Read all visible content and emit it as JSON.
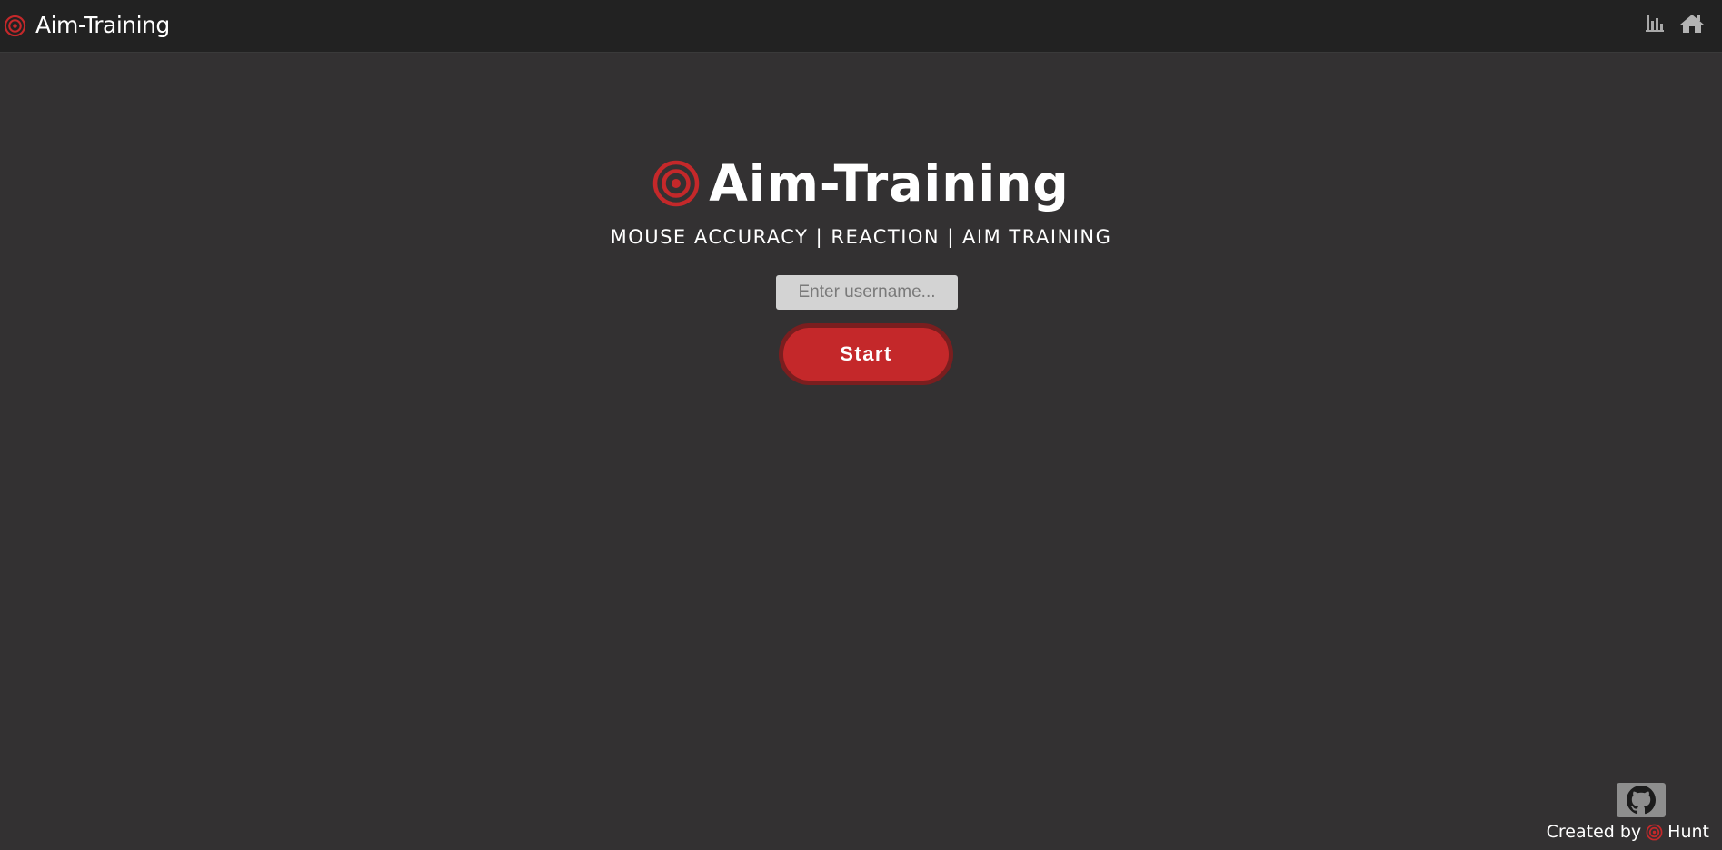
{
  "navbar": {
    "brand_icon": "target-icon",
    "brand_text": "Aim-Training",
    "stats_icon": "bar-chart-icon",
    "home_icon": "home-icon"
  },
  "hero": {
    "icon": "target-icon",
    "title": "Aim-Training",
    "tagline": "MOUSE ACCURACY | REACTION | AIM TRAINING"
  },
  "form": {
    "username_value": "",
    "username_placeholder": "Enter username...",
    "start_label": "Start"
  },
  "footer": {
    "github_icon": "github-icon",
    "created_by": "Created by",
    "author_icon": "target-icon",
    "author": "Hunt"
  },
  "colors": {
    "accent": "#c4282a",
    "background": "#333132",
    "navbar": "#222222"
  }
}
